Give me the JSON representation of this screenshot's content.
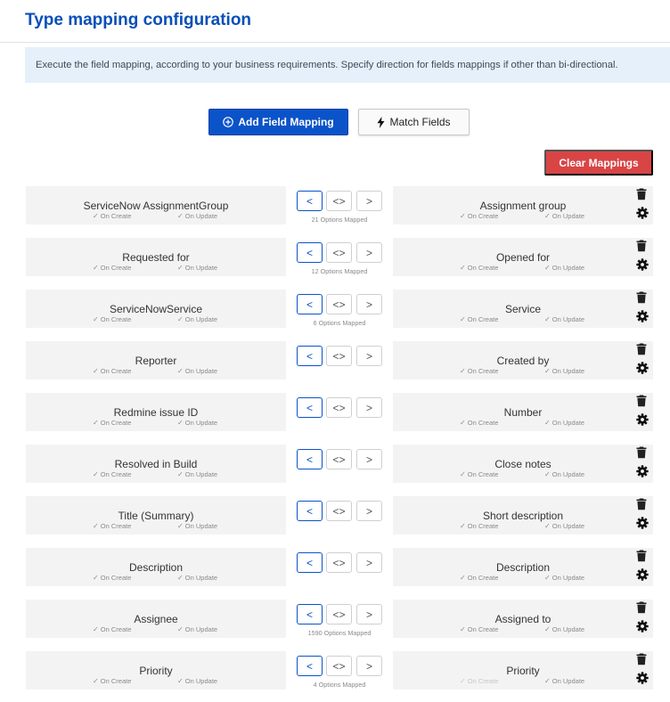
{
  "page": {
    "title": "Type mapping configuration",
    "info": "Execute the field mapping, according to your business requirements. Specify direction for fields mappings if other than bi-directional."
  },
  "toolbar": {
    "add_label": "Add Field Mapping",
    "match_label": "Match Fields",
    "clear_label": "Clear Mappings"
  },
  "icons": {
    "add": "plus-circle-icon",
    "match": "lightning-icon",
    "delete": "trash-icon",
    "settings": "gear-icon",
    "check": "check-icon"
  },
  "colors": {
    "primary": "#0b53c8",
    "danger": "#d94545",
    "title": "#0a4fb8",
    "banner": "#e5f0fb"
  },
  "direction_labels": {
    "left": "<",
    "both": "<>",
    "right": ">"
  },
  "mappings": [
    {
      "source": "ServiceNow AssignmentGroup",
      "target": "Assignment group",
      "on_create": "On Create",
      "on_update": "On Update",
      "target_on_create": "On Create",
      "target_on_update": "On Update",
      "options_mapped": "21 Options Mapped"
    },
    {
      "source": "Requested for",
      "target": "Opened for",
      "on_create": "On Create",
      "on_update": "On Update",
      "target_on_create": "On Create",
      "target_on_update": "On Update",
      "options_mapped": "12 Options Mapped"
    },
    {
      "source": "ServiceNowService",
      "target": "Service",
      "on_create": "On Create",
      "on_update": "On Update",
      "target_on_create": "On Create",
      "target_on_update": "On Update",
      "options_mapped": "6 Options Mapped"
    },
    {
      "source": "Reporter",
      "target": "Created by",
      "on_create": "On Create",
      "on_update": "On Update",
      "target_on_create": "On Create",
      "target_on_update": "On Update",
      "options_mapped": ""
    },
    {
      "source": "Redmine issue ID",
      "target": "Number",
      "on_create": "On Create",
      "on_update": "On Update",
      "target_on_create": "On Create",
      "target_on_update": "On Update",
      "options_mapped": ""
    },
    {
      "source": "Resolved in Build",
      "target": "Close notes",
      "on_create": "On Create",
      "on_update": "On Update",
      "target_on_create": "On Create",
      "target_on_update": "On Update",
      "options_mapped": ""
    },
    {
      "source": "Title (Summary)",
      "target": "Short description",
      "on_create": "On Create",
      "on_update": "On Update",
      "target_on_create": "On Create",
      "target_on_update": "On Update",
      "options_mapped": ""
    },
    {
      "source": "Description",
      "target": "Description",
      "on_create": "On Create",
      "on_update": "On Update",
      "target_on_create": "On Create",
      "target_on_update": "On Update",
      "options_mapped": ""
    },
    {
      "source": "Assignee",
      "target": "Assigned to",
      "on_create": "On Create",
      "on_update": "On Update",
      "target_on_create": "On Create",
      "target_on_update": "On Update",
      "options_mapped": "1590 Options Mapped"
    },
    {
      "source": "Priority",
      "target": "Priority",
      "on_create": "On Create",
      "on_update": "On Update",
      "target_on_create": "On Create",
      "target_on_update": "On Update",
      "target_on_create_disabled": true,
      "options_mapped": "4 Options Mapped"
    }
  ]
}
